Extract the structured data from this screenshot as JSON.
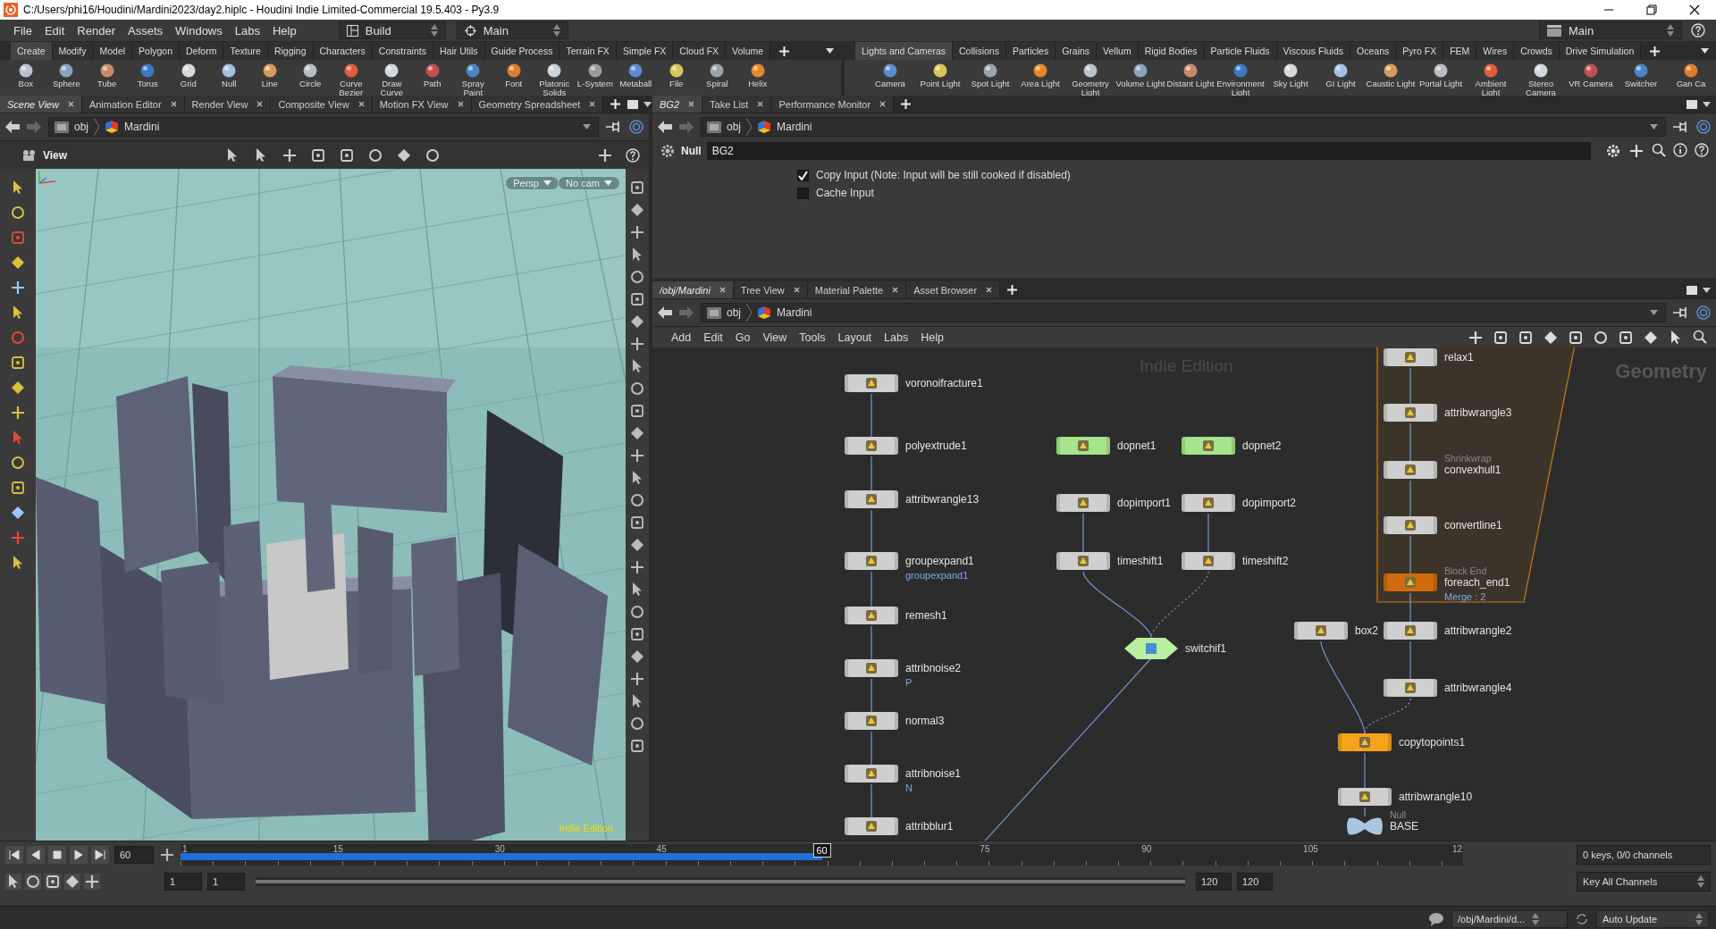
{
  "window": {
    "title": "C:/Users/phi16/Houdini/Mardini2023/day2.hiplc - Houdini Indie Limited-Commercial 19.5.403 - Py3.9"
  },
  "menu_bar": {
    "items": [
      "File",
      "Edit",
      "Render",
      "Assets",
      "Windows",
      "Labs",
      "Help"
    ],
    "desktop": "Build",
    "context": "Main",
    "right_desktop": "Main"
  },
  "shelves": [
    {
      "tabs": [
        {
          "label": "Create",
          "selected": true
        },
        {
          "label": "Modify",
          "selected": false
        },
        {
          "label": "Model",
          "selected": false
        },
        {
          "label": "Polygon",
          "selected": false
        },
        {
          "label": "Deform",
          "selected": false
        },
        {
          "label": "Texture",
          "selected": false
        },
        {
          "label": "Rigging",
          "selected": false
        },
        {
          "label": "Characters",
          "selected": false
        },
        {
          "label": "Constraints",
          "selected": false
        },
        {
          "label": "Hair Utils",
          "selected": false
        },
        {
          "label": "Guide Process",
          "selected": false
        },
        {
          "label": "Terrain FX",
          "selected": false
        },
        {
          "label": "Simple FX",
          "selected": false
        },
        {
          "label": "Cloud FX",
          "selected": false
        },
        {
          "label": "Volume",
          "selected": false
        }
      ],
      "tools": [
        "Box",
        "Sphere",
        "Tube",
        "Torus",
        "Grid",
        "Null",
        "Line",
        "Circle",
        "Curve Bezier",
        "Draw Curve",
        "Path",
        "Spray Paint",
        "Font",
        "Platonic Solids",
        "L-System",
        "Metaball",
        "File",
        "Spiral",
        "Helix"
      ]
    },
    {
      "tabs": [
        {
          "label": "Lights and Cameras",
          "selected": true
        },
        {
          "label": "Collisions",
          "selected": false
        },
        {
          "label": "Particles",
          "selected": false
        },
        {
          "label": "Grains",
          "selected": false
        },
        {
          "label": "Vellum",
          "selected": false
        },
        {
          "label": "Rigid Bodies",
          "selected": false
        },
        {
          "label": "Particle Fluids",
          "selected": false
        },
        {
          "label": "Viscous Fluids",
          "selected": false
        },
        {
          "label": "Oceans",
          "selected": false
        },
        {
          "label": "Pyro FX",
          "selected": false
        },
        {
          "label": "FEM",
          "selected": false
        },
        {
          "label": "Wires",
          "selected": false
        },
        {
          "label": "Crowds",
          "selected": false
        },
        {
          "label": "Drive Simulation",
          "selected": false
        }
      ],
      "tools": [
        "Camera",
        "Point Light",
        "Spot Light",
        "Area Light",
        "Geometry Light",
        "Volume Light",
        "Distant Light",
        "Environment Light",
        "Sky Light",
        "GI Light",
        "Caustic Light",
        "Portal Light",
        "Ambient Light",
        "Stereo Camera",
        "VR Camera",
        "Switcher",
        "Gan Ca"
      ]
    }
  ],
  "scene_view": {
    "tabs": [
      {
        "label": "Scene View",
        "selected": true
      },
      {
        "label": "Animation Editor",
        "selected": false
      },
      {
        "label": "Render View",
        "selected": false
      },
      {
        "label": "Composite View",
        "selected": false
      },
      {
        "label": "Motion FX View",
        "selected": false
      },
      {
        "label": "Geometry Spreadsheet",
        "selected": false
      }
    ],
    "path": [
      "obj",
      "Mardini"
    ],
    "toolbar_title": "View",
    "camera_menus": [
      "Persp",
      "No cam"
    ],
    "edition": "Indie Edition"
  },
  "parameters": {
    "tabs": [
      {
        "label": "BG2",
        "selected": true
      },
      {
        "label": "Take List",
        "selected": false
      },
      {
        "label": "Performance Monitor",
        "selected": false
      }
    ],
    "path": [
      "obj",
      "Mardini"
    ],
    "node_type": "Null",
    "node_name": "BG2",
    "options": [
      {
        "label": "Copy Input (Note: Input will be still cooked if disabled)",
        "checked": true
      },
      {
        "label": "Cache Input",
        "checked": false
      }
    ]
  },
  "network": {
    "tabs": [
      {
        "label": "/obj/Mardini",
        "selected": true
      },
      {
        "label": "Tree View",
        "selected": false
      },
      {
        "label": "Material Palette",
        "selected": false
      },
      {
        "label": "Asset Browser",
        "selected": false
      }
    ],
    "path": [
      "obj",
      "Mardini"
    ],
    "menus": [
      "Add",
      "Edit",
      "Go",
      "View",
      "Tools",
      "Layout",
      "Labs",
      "Help"
    ],
    "edition": "Indie Edition",
    "context": "Geometry",
    "nodes": [
      {
        "name": "voronoifracture1",
        "kind": "node",
        "color": "#cfcfcf"
      },
      {
        "name": "polyextrude1",
        "kind": "node",
        "color": "#cfcfcf"
      },
      {
        "name": "attribwrangle13",
        "kind": "node",
        "color": "#cfcfcf"
      },
      {
        "name": "groupexpand1",
        "kind": "node",
        "color": "#cfcfcf",
        "below": "groupexpand1"
      },
      {
        "name": "remesh1",
        "kind": "node",
        "color": "#cfcfcf"
      },
      {
        "name": "attribnoise2",
        "kind": "node",
        "color": "#cfcfcf",
        "below": "P"
      },
      {
        "name": "normal3",
        "kind": "node",
        "color": "#cfcfcf"
      },
      {
        "name": "attribnoise1",
        "kind": "node",
        "color": "#cfcfcf",
        "below": "N"
      },
      {
        "name": "attribblur1",
        "kind": "node",
        "color": "#cfcfcf"
      },
      {
        "name": "dopnet1",
        "kind": "node",
        "color": "#a6e48c"
      },
      {
        "name": "dopnet2",
        "kind": "node",
        "color": "#a6e48c"
      },
      {
        "name": "dopimport1",
        "kind": "node",
        "color": "#cfcfcf"
      },
      {
        "name": "dopimport2",
        "kind": "node",
        "color": "#cfcfcf"
      },
      {
        "name": "timeshift1",
        "kind": "node",
        "color": "#cfcfcf"
      },
      {
        "name": "timeshift2",
        "kind": "node",
        "color": "#cfcfcf"
      },
      {
        "name": "switchif1",
        "kind": "diamond",
        "color": "#b8f0a0"
      },
      {
        "name": "relax1",
        "kind": "node",
        "color": "#cfcfcf"
      },
      {
        "name": "attribwrangle3",
        "kind": "node",
        "color": "#cfcfcf"
      },
      {
        "name": "convexhull1",
        "kind": "node",
        "color": "#cfcfcf",
        "above": "Shrinkwrap"
      },
      {
        "name": "convertline1",
        "kind": "node",
        "color": "#cfcfcf"
      },
      {
        "name": "foreach_end1",
        "kind": "node",
        "color": "#d06a0a",
        "above": "Block End",
        "below": "Merge : 2"
      },
      {
        "name": "box2",
        "kind": "node",
        "color": "#cfcfcf"
      },
      {
        "name": "attribwrangle2",
        "kind": "node",
        "color": "#cfcfcf"
      },
      {
        "name": "attribwrangle4",
        "kind": "node",
        "color": "#cfcfcf"
      },
      {
        "name": "copytopoints1",
        "kind": "node",
        "color": "#f5a31a"
      },
      {
        "name": "attribwrangle10",
        "kind": "node",
        "color": "#cfcfcf"
      },
      {
        "name": "BASE",
        "kind": "null",
        "color": "#a9c6e0",
        "above": "Null"
      }
    ]
  },
  "timeline": {
    "frame": "60",
    "ticks": [
      "1",
      "15",
      "30",
      "45",
      "75",
      "90",
      "105",
      "12"
    ],
    "current": "60",
    "level": 0.5,
    "range": {
      "level": 1
    },
    "start": "1",
    "range_start": "1",
    "range_end": "120",
    "end": "120",
    "keys": "0 keys, 0/0 channels",
    "key_button": "Key All Channels"
  },
  "status_bar": {
    "path": "/obj/Mardini/d...",
    "update": "Auto Update"
  }
}
